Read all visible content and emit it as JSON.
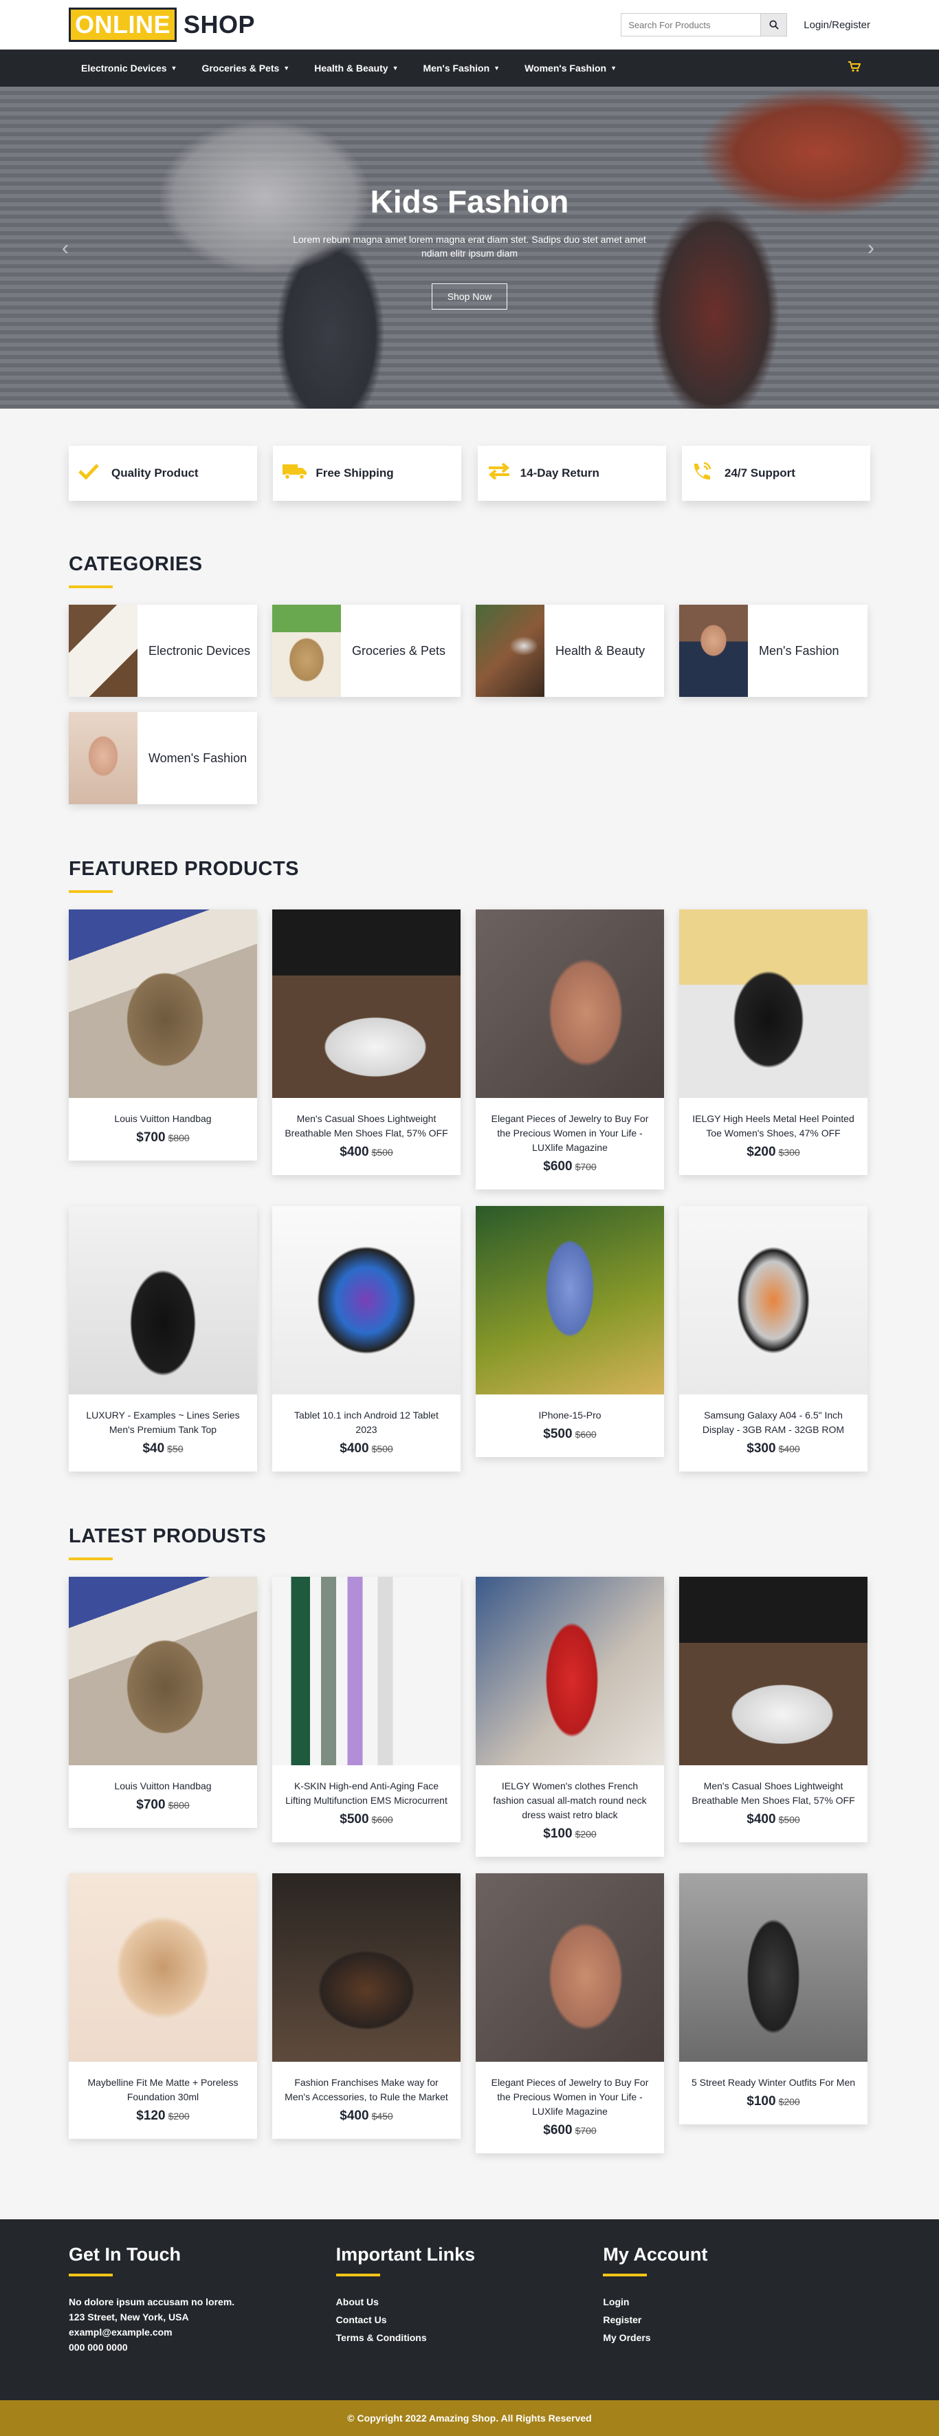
{
  "header": {
    "logo_part1": "ONLINE",
    "logo_part2": "SHOP",
    "search_placeholder": "Search For Products",
    "login_label": "Login/Register"
  },
  "nav": {
    "items": [
      {
        "label": "Electronic Devices"
      },
      {
        "label": "Groceries & Pets"
      },
      {
        "label": "Health & Beauty"
      },
      {
        "label": "Men's Fashion"
      },
      {
        "label": "Women's Fashion"
      }
    ],
    "cart_icon": "cart-icon"
  },
  "hero": {
    "title": "Kids Fashion",
    "subtitle": "Lorem rebum magna amet lorem magna erat diam stet. Sadips duo stet amet amet ndiam elitr ipsum diam",
    "button": "Shop Now"
  },
  "features": [
    {
      "icon": "check-icon",
      "label": "Quality Product"
    },
    {
      "icon": "truck-icon",
      "label": "Free Shipping"
    },
    {
      "icon": "exchange-icon",
      "label": "14-Day Return"
    },
    {
      "icon": "phone-icon",
      "label": "24/7 Support"
    }
  ],
  "categories": {
    "title": "CATEGORIES",
    "items": [
      {
        "name": "Electronic Devices"
      },
      {
        "name": "Groceries & Pets"
      },
      {
        "name": "Health & Beauty"
      },
      {
        "name": "Men's Fashion"
      },
      {
        "name": "Women's Fashion"
      }
    ]
  },
  "featured": {
    "title": "FEATURED PRODUCTS",
    "items": [
      {
        "name": "Louis Vuitton Handbag",
        "price": "$700",
        "old_price": "$800"
      },
      {
        "name": "Men's Casual Shoes Lightweight Breathable Men Shoes Flat, 57% OFF",
        "price": "$400",
        "old_price": "$500"
      },
      {
        "name": "Elegant Pieces of Jewelry to Buy For the Precious Women in Your Life - LUXlife Magazine",
        "price": "$600",
        "old_price": "$700"
      },
      {
        "name": "IELGY High Heels Metal Heel Pointed Toe Women's Shoes, 47% OFF",
        "price": "$200",
        "old_price": "$300"
      },
      {
        "name": "LUXURY - Examples ~ Lines Series Men's Premium Tank Top",
        "price": "$40",
        "old_price": "$50"
      },
      {
        "name": "Tablet 10.1 inch Android 12 Tablet 2023",
        "price": "$400",
        "old_price": "$500"
      },
      {
        "name": "IPhone-15-Pro",
        "price": "$500",
        "old_price": "$600"
      },
      {
        "name": "Samsung Galaxy A04 - 6.5\" Inch Display - 3GB RAM - 32GB ROM",
        "price": "$300",
        "old_price": "$400"
      }
    ]
  },
  "latest": {
    "title": "LATEST PRODUSTS",
    "items": [
      {
        "name": "Louis Vuitton Handbag",
        "price": "$700",
        "old_price": "$800"
      },
      {
        "name": "K-SKIN High-end Anti-Aging Face Lifting Multifunction EMS Microcurrent",
        "price": "$500",
        "old_price": "$600"
      },
      {
        "name": "IELGY Women's clothes French fashion casual all-match round neck dress waist retro black",
        "price": "$100",
        "old_price": "$200"
      },
      {
        "name": "Men's Casual Shoes Lightweight Breathable Men Shoes Flat, 57% OFF",
        "price": "$400",
        "old_price": "$500"
      },
      {
        "name": "Maybelline Fit Me Matte + Poreless Foundation 30ml",
        "price": "$120",
        "old_price": "$200"
      },
      {
        "name": "Fashion Franchises Make way for Men's Accessories, to Rule the Market",
        "price": "$400",
        "old_price": "$450"
      },
      {
        "name": "Elegant Pieces of Jewelry to Buy For the Precious Women in Your Life - LUXlife Magazine",
        "price": "$600",
        "old_price": "$700"
      },
      {
        "name": "5 Street Ready Winter Outfits For Men",
        "price": "$100",
        "old_price": "$200"
      }
    ]
  },
  "footer": {
    "get_in_touch": {
      "title": "Get In Touch",
      "lines": [
        "No dolore ipsum accusam no lorem.",
        "123 Street, New York, USA",
        "exampl@example.com",
        "000 000 0000"
      ]
    },
    "important_links": {
      "title": "Important Links",
      "links": [
        "About Us",
        "Contact Us",
        "Terms & Conditions"
      ]
    },
    "my_account": {
      "title": "My Account",
      "links": [
        "Login",
        "Register",
        "My Orders"
      ]
    },
    "copyright": "© Copyright 2022 Amazing Shop. All Rights Reserved"
  },
  "colors": {
    "accent": "#f5c518",
    "dark": "#24272c",
    "footer_bar": "#a5821a"
  }
}
